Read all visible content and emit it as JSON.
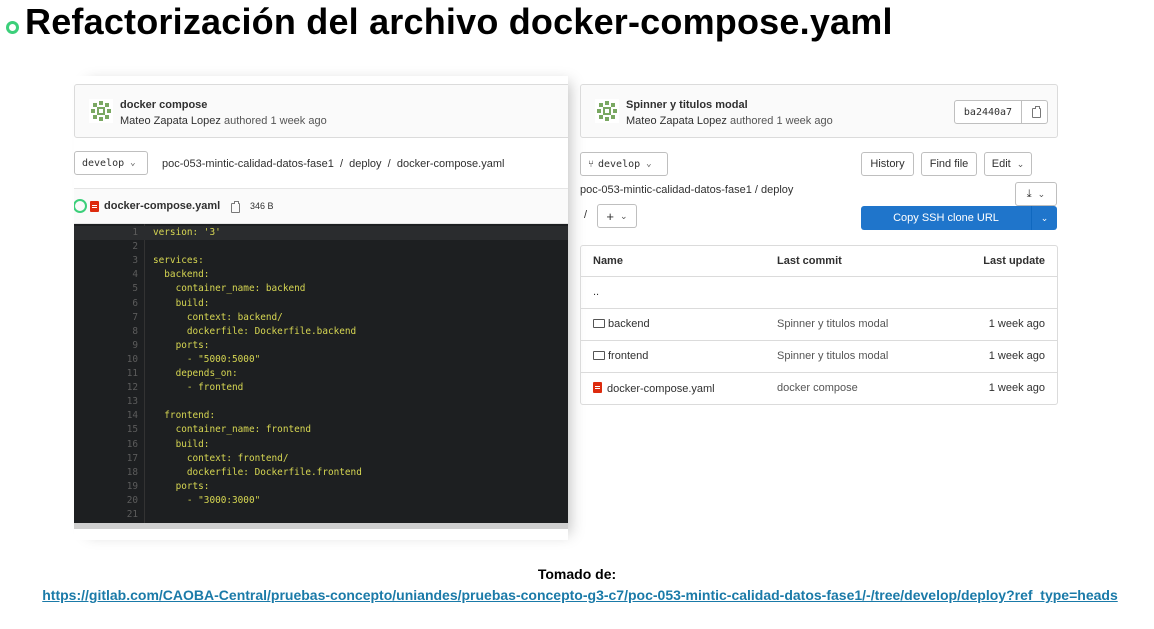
{
  "slide": {
    "title": "Refactorización del archivo docker-compose.yaml",
    "bullet_color": "#3ccf7a"
  },
  "left": {
    "commit": {
      "title": "docker compose",
      "author": "Mateo Zapata Lopez",
      "meta": "authored 1 week ago"
    },
    "branch": "develop",
    "breadcrumb": [
      "poc-053-mintic-calidad-datos-fase1",
      "/",
      "deploy",
      "/",
      "docker-compose.yaml"
    ],
    "file": {
      "name": "docker-compose.yaml",
      "size": "346 B",
      "icon": "file-icon"
    },
    "code_lines": [
      "version: '3'",
      "",
      "services:",
      "  backend:",
      "    container_name: backend",
      "    build:",
      "      context: backend/",
      "      dockerfile: Dockerfile.backend",
      "    ports:",
      "      - \"5000:5000\"",
      "    depends_on:",
      "      - frontend",
      "",
      "  frontend:",
      "    container_name: frontend",
      "    build:",
      "      context: frontend/",
      "      dockerfile: Dockerfile.frontend",
      "    ports:",
      "      - \"3000:3000\"",
      ""
    ]
  },
  "right": {
    "commit": {
      "title": "Spinner y titulos modal",
      "author": "Mateo Zapata Lopez",
      "meta": "authored 1 week ago",
      "sha": "ba2440a7"
    },
    "branch": "develop",
    "buttons": {
      "history": "History",
      "find_file": "Find file",
      "edit": "Edit"
    },
    "breadcrumb": "poc-053-mintic-calidad-datos-fase1  /  deploy",
    "path_slash": "/",
    "add_btn": "+",
    "clone_btn": "Copy SSH clone URL",
    "table": {
      "headers": [
        "Name",
        "Last commit",
        "Last update"
      ],
      "parent": "..",
      "rows": [
        {
          "name": "backend",
          "type": "folder",
          "commit": "Spinner y titulos modal",
          "updated": "1 week ago"
        },
        {
          "name": "frontend",
          "type": "folder",
          "commit": "Spinner y titulos modal",
          "updated": "1 week ago"
        },
        {
          "name": "docker-compose.yaml",
          "type": "file",
          "commit": "docker compose",
          "updated": "1 week ago"
        }
      ]
    }
  },
  "footer": {
    "label": "Tomado de:",
    "url": "https://gitlab.com/CAOBA-Central/pruebas-concepto/uniandes/pruebas-concepto-g3-c7/poc-053-mintic-calidad-datos-fase1/-/tree/develop/deploy?ref_type=heads"
  }
}
